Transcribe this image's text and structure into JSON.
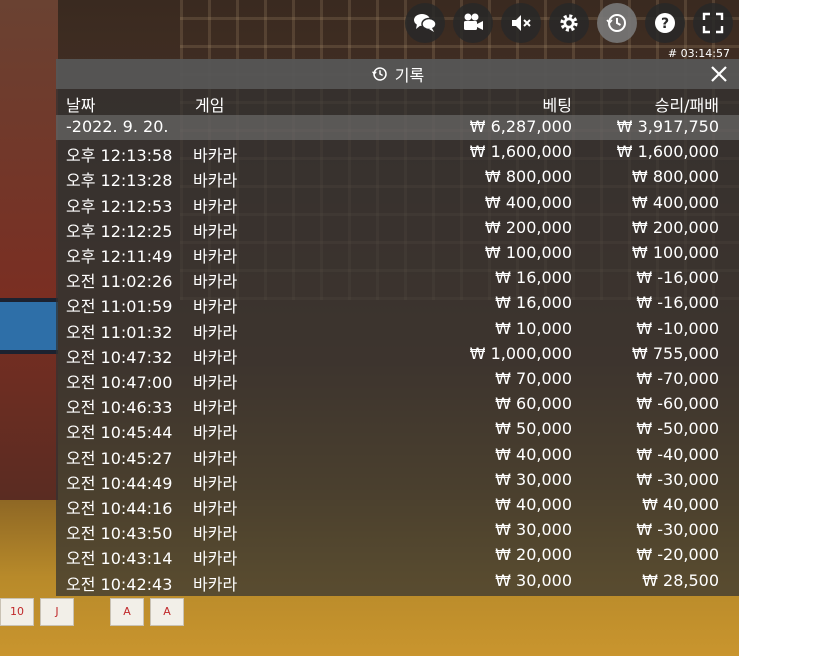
{
  "toolbar": {
    "buttons": [
      {
        "name": "chat-icon",
        "active": false
      },
      {
        "name": "video-camera-icon",
        "active": false
      },
      {
        "name": "mute-icon",
        "active": false
      },
      {
        "name": "gear-icon",
        "active": false
      },
      {
        "name": "history-icon",
        "active": true
      },
      {
        "name": "help-icon",
        "active": false
      },
      {
        "name": "fullscreen-icon",
        "active": false
      }
    ],
    "time_badge": "# 03:14:57"
  },
  "panel": {
    "title": "기록",
    "columns": {
      "date": "날짜",
      "game": "게임",
      "bet": "베팅",
      "win_loss": "승리/패배"
    },
    "summary": {
      "date": "-2022. 9. 20.",
      "bet": "₩ 6,287,000",
      "win_loss": "₩ 3,917,750"
    },
    "rows": [
      {
        "date": "오후 12:13:58",
        "game": "바카라",
        "bet": "₩ 1,600,000",
        "win_loss": "₩ 1,600,000"
      },
      {
        "date": "오후 12:13:28",
        "game": "바카라",
        "bet": "₩ 800,000",
        "win_loss": "₩ 800,000"
      },
      {
        "date": "오후 12:12:53",
        "game": "바카라",
        "bet": "₩ 400,000",
        "win_loss": "₩ 400,000"
      },
      {
        "date": "오후 12:12:25",
        "game": "바카라",
        "bet": "₩ 200,000",
        "win_loss": "₩ 200,000"
      },
      {
        "date": "오후 12:11:49",
        "game": "바카라",
        "bet": "₩ 100,000",
        "win_loss": "₩ 100,000"
      },
      {
        "date": "오전 11:02:26",
        "game": "바카라",
        "bet": "₩ 16,000",
        "win_loss": "₩ -16,000"
      },
      {
        "date": "오전 11:01:59",
        "game": "바카라",
        "bet": "₩ 16,000",
        "win_loss": "₩ -16,000"
      },
      {
        "date": "오전 11:01:32",
        "game": "바카라",
        "bet": "₩ 10,000",
        "win_loss": "₩ -10,000"
      },
      {
        "date": "오전 10:47:32",
        "game": "바카라",
        "bet": "₩ 1,000,000",
        "win_loss": "₩ 755,000"
      },
      {
        "date": "오전 10:47:00",
        "game": "바카라",
        "bet": "₩ 70,000",
        "win_loss": "₩ -70,000"
      },
      {
        "date": "오전 10:46:33",
        "game": "바카라",
        "bet": "₩ 60,000",
        "win_loss": "₩ -60,000"
      },
      {
        "date": "오전 10:45:44",
        "game": "바카라",
        "bet": "₩ 50,000",
        "win_loss": "₩ -50,000"
      },
      {
        "date": "오전 10:45:27",
        "game": "바카라",
        "bet": "₩ 40,000",
        "win_loss": "₩ -40,000"
      },
      {
        "date": "오전 10:44:49",
        "game": "바카라",
        "bet": "₩ 30,000",
        "win_loss": "₩ -30,000"
      },
      {
        "date": "오전 10:44:16",
        "game": "바카라",
        "bet": "₩ 40,000",
        "win_loss": "₩ 40,000"
      },
      {
        "date": "오전 10:43:50",
        "game": "바카라",
        "bet": "₩ 30,000",
        "win_loss": "₩ -30,000"
      },
      {
        "date": "오전 10:43:14",
        "game": "바카라",
        "bet": "₩ 20,000",
        "win_loss": "₩ -20,000"
      },
      {
        "date": "오전 10:42:43",
        "game": "바카라",
        "bet": "₩ 30,000",
        "win_loss": "₩ 28,500"
      }
    ]
  },
  "background": {
    "cards": [
      "10",
      "J",
      "A",
      "A"
    ]
  }
}
